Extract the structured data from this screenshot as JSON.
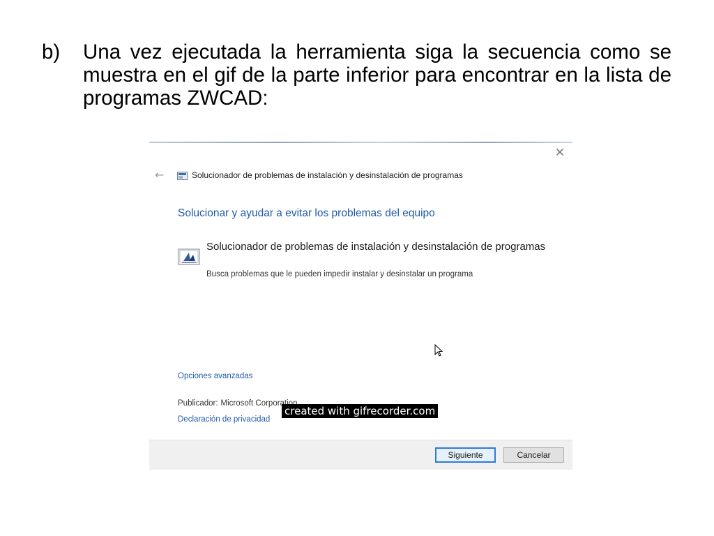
{
  "slide": {
    "marker": "b)",
    "text": "Una vez ejecutada la herramienta siga la secuencia como se muestra en el gif de la parte inferior para encontrar en la lista de programas ZWCAD:"
  },
  "dialog": {
    "close_glyph": "✕",
    "back_glyph": "←",
    "window_title": "Solucionador de problemas de instalación y desinstalación de programas",
    "heading": "Solucionar y ayudar a evitar los problemas del equipo",
    "troubleshooter": {
      "title": "Solucionador de problemas de instalación y desinstalación de programas",
      "description": "Busca problemas que le pueden impedir instalar y desinstalar un programa",
      "icon": "program-install-icon"
    },
    "advanced_link": "Opciones avanzadas",
    "publisher_label": "Publicador:",
    "publisher_value": "Microsoft Corporation",
    "privacy_link": "Declaración de privacidad",
    "watermark": "created with gifrecorder.com",
    "buttons": {
      "next": "Siguiente",
      "cancel": "Cancelar"
    }
  },
  "colors": {
    "link_blue": "#1f5aa8",
    "footer_bg": "#f0f0f0",
    "focus_border": "#2f7bd6"
  }
}
